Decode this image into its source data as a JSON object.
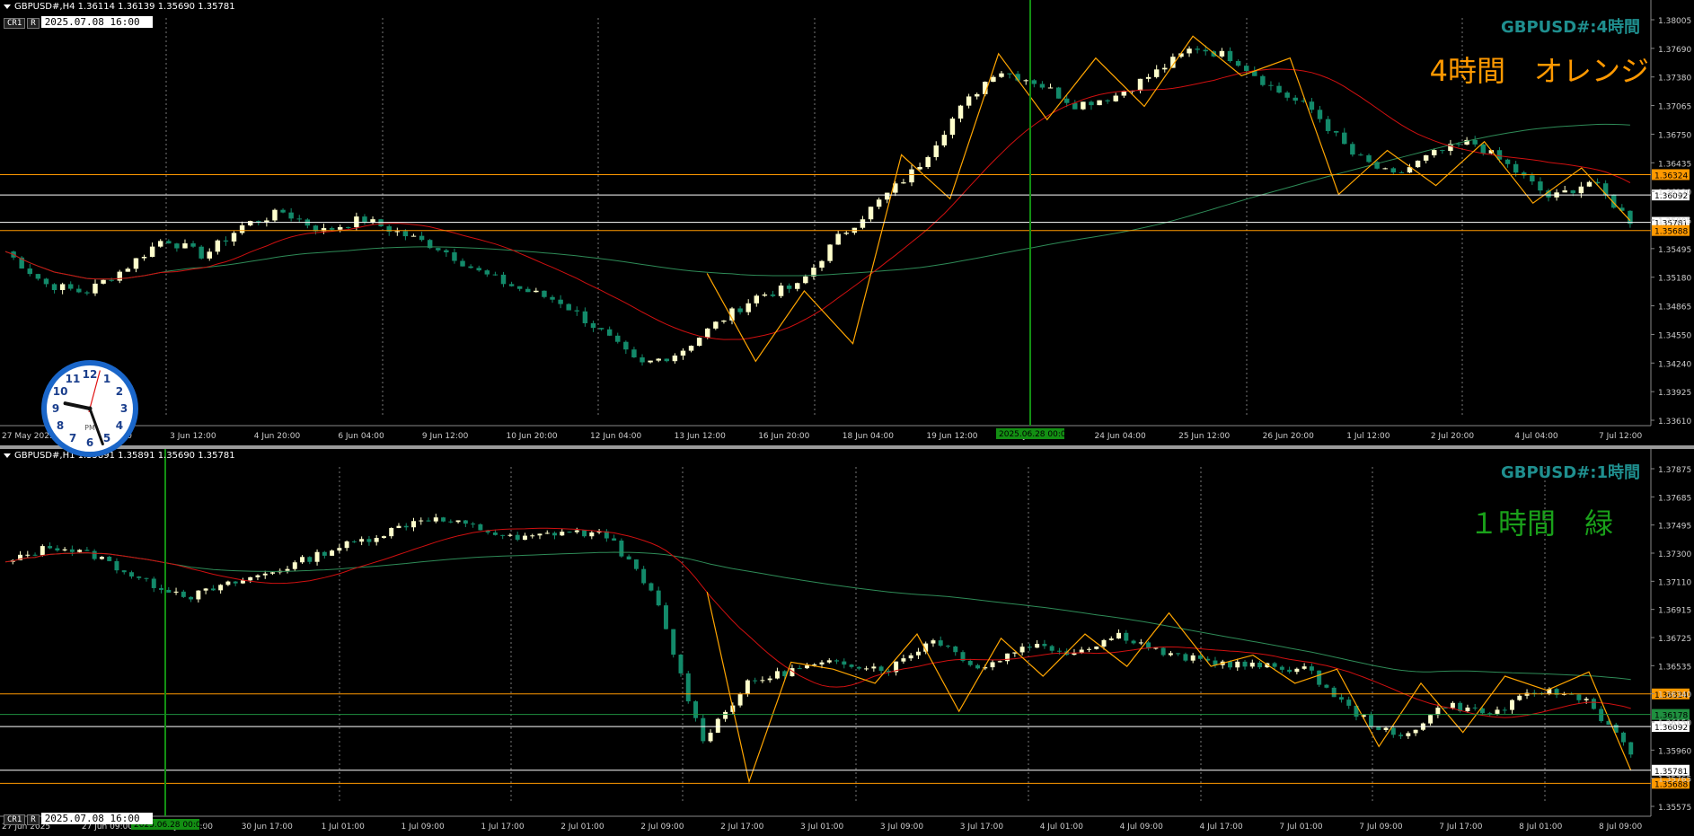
{
  "top": {
    "header": "GBPUSD#,H4  1.36114 1.36139 1.35690 1.35781",
    "buttons": [
      "CR1",
      "R"
    ],
    "datetime": "2025.07.08 16:00",
    "title": "GBPUSD#:4時間",
    "subtitle": "4時間　オレンジ",
    "price_labels": [
      "1.38005",
      "1.37690",
      "1.37380",
      "1.37065",
      "1.36750",
      "1.36435",
      "1.36120",
      "1.35805",
      "1.35495",
      "1.35180",
      "1.34865",
      "1.34550",
      "1.34240",
      "1.33925",
      "1.33610"
    ],
    "time_labels": [
      "27 May 2025",
      "2 Jun 04:00",
      "3 Jun 12:00",
      "4 Jun 20:00",
      "6 Jun 04:00",
      "9 Jun 12:00",
      "10 Jun 20:00",
      "12 Jun 04:00",
      "13 Jun 12:00",
      "16 Jun 20:00",
      "18 Jun 04:00",
      "19 Jun 12:00",
      "20 Jun 20:00",
      "24 Jun 04:00",
      "25 Jun 12:00",
      "26 Jun 20:00",
      "1 Jul 12:00",
      "2 Jul 20:00",
      "4 Jul 04:00",
      "7 Jul 12:00"
    ],
    "cursor_time": "2025.06.28 00:00",
    "hlines": [
      {
        "price": 1.36324,
        "color": "#ff9900",
        "label": "1.36324"
      },
      {
        "price": 1.36092,
        "color": "#ffffff",
        "label": "1.36092"
      },
      {
        "price": 1.35781,
        "color": "#ffffff",
        "label": "1.35781"
      },
      {
        "price": 1.35688,
        "color": "#ff9900",
        "label": "1.35688"
      }
    ]
  },
  "bottom": {
    "header": "GBPUSD#,H1  1.35891 1.35891 1.35690 1.35781",
    "buttons": [
      "CR1",
      "R"
    ],
    "datetime": "2025.07.08 16:00",
    "title": "GBPUSD#:1時間",
    "subtitle": "１時間　緑",
    "price_labels": [
      "1.37875",
      "1.37685",
      "1.37495",
      "1.37300",
      "1.37110",
      "1.36915",
      "1.36725",
      "1.36535",
      "1.36340",
      "1.36150",
      "1.35960",
      "1.35765",
      "1.35575"
    ],
    "time_labels": [
      "27 Jun 2025",
      "27 Jun 09:00",
      "30 Jun 01:00",
      "30 Jun 17:00",
      "1 Jul 01:00",
      "1 Jul 09:00",
      "1 Jul 17:00",
      "2 Jul 01:00",
      "2 Jul 09:00",
      "2 Jul 17:00",
      "3 Jul 01:00",
      "3 Jul 09:00",
      "3 Jul 17:00",
      "4 Jul 01:00",
      "4 Jul 09:00",
      "4 Jul 17:00",
      "7 Jul 01:00",
      "7 Jul 09:00",
      "7 Jul 17:00",
      "8 Jul 01:00",
      "8 Jul 09:00"
    ],
    "cursor_time": "2025.06.28 00:00",
    "hlines": [
      {
        "price": 1.36324,
        "color": "#ff9900",
        "label": "1.36324"
      },
      {
        "price": 1.36178,
        "color": "#1f8f3f",
        "label": "1.36178"
      },
      {
        "price": 1.36092,
        "color": "#ffffff",
        "label": "1.36092"
      },
      {
        "price": 1.35781,
        "color": "#ffffff",
        "label": "1.35781"
      },
      {
        "price": 1.35688,
        "color": "#ff9900",
        "label": "1.35688"
      }
    ]
  },
  "colors": {
    "orange": "#ff9900",
    "green_text": "#1aa01a",
    "teal": "#1f8f8f",
    "bull": "#ffffcc",
    "bear": "#138a6a",
    "ma_red": "#d01010",
    "ma_green": "#2e8b57",
    "zigzag": "#ffa500",
    "vline": "#138f13"
  },
  "clock": {
    "label": "PM",
    "numbers": [
      "12",
      "1",
      "2",
      "3",
      "4",
      "5",
      "6",
      "7",
      "8",
      "9",
      "10",
      "11"
    ],
    "hour_deg": -78,
    "minute_deg": 160,
    "second_deg": 15
  },
  "chart_data": [
    {
      "type": "candlestick",
      "title": "GBPUSD#:4時間",
      "ylim": [
        1.3361,
        1.38005
      ],
      "ohlc_seed": [
        1.3545,
        1.3508,
        1.3498,
        1.3525,
        1.356,
        1.354,
        1.3575,
        1.359,
        1.3568,
        1.3582,
        1.3565,
        1.3548,
        1.352,
        1.3502,
        1.3488,
        1.3455,
        1.3415,
        1.343,
        1.3465,
        1.3495,
        1.3505,
        1.356,
        1.36,
        1.364,
        1.3702,
        1.3752,
        1.3738,
        1.3712,
        1.3722,
        1.3748,
        1.3778,
        1.3765,
        1.373,
        1.3705,
        1.3655,
        1.363,
        1.3655,
        1.367,
        1.364,
        1.3605,
        1.3625,
        1.358
      ],
      "zigzag": [
        1.352,
        1.342,
        1.35,
        1.344,
        1.3655,
        1.3605,
        1.377,
        1.3695,
        1.3765,
        1.371,
        1.379,
        1.3745,
        1.3765,
        1.361,
        1.366,
        1.362,
        1.367,
        1.36,
        1.364,
        1.358
      ]
    },
    {
      "type": "candlestick",
      "title": "GBPUSD#:1時間",
      "ylim": [
        1.35575,
        1.37875
      ],
      "ohlc_seed": [
        1.3725,
        1.3738,
        1.373,
        1.3712,
        1.3702,
        1.3712,
        1.3722,
        1.3735,
        1.3745,
        1.3758,
        1.3752,
        1.3742,
        1.3748,
        1.3745,
        1.37,
        1.36,
        1.364,
        1.365,
        1.3655,
        1.365,
        1.3672,
        1.365,
        1.3668,
        1.3662,
        1.3675,
        1.366,
        1.3655,
        1.3652,
        1.365,
        1.362,
        1.36,
        1.3625,
        1.3618,
        1.3635,
        1.363,
        1.359
      ],
      "zigzag": [
        1.3705,
        1.357,
        1.3655,
        1.365,
        1.364,
        1.3675,
        1.362,
        1.3672,
        1.3645,
        1.3675,
        1.3652,
        1.369,
        1.3652,
        1.366,
        1.364,
        1.365,
        1.3595,
        1.364,
        1.3605,
        1.3645,
        1.3635,
        1.3648,
        1.3578
      ]
    }
  ]
}
